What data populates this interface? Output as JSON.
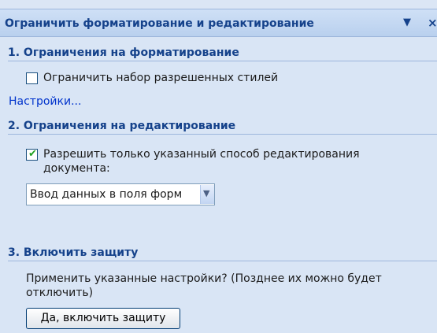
{
  "pane": {
    "title": "Ограничить форматирование и редактирование",
    "menu_glyph": "▼",
    "close_glyph": "×"
  },
  "section1": {
    "heading": "1. Ограничения на форматирование",
    "checkbox_label": "Ограничить набор разрешенных стилей",
    "checkbox_checked": false,
    "settings_link": "Настройки..."
  },
  "section2": {
    "heading": "2. Ограничения на редактирование",
    "checkbox_label_line1": "Разрешить только указанный способ редактирования",
    "checkbox_label_line2": "документа:",
    "checkbox_checked": true,
    "mode_select_value": "Ввод данных в поля форм"
  },
  "section3": {
    "heading": "3. Включить защиту",
    "prompt_line1": "Применить указанные настройки? (Позднее их можно будет",
    "prompt_line2": "отключить)",
    "enable_button": "Да, включить защиту"
  },
  "icons": {
    "check": "✔",
    "dropdown": "▼"
  },
  "colors": {
    "heading": "#15428b",
    "link": "#0033cc",
    "pane_bg": "#d9e5f5"
  }
}
